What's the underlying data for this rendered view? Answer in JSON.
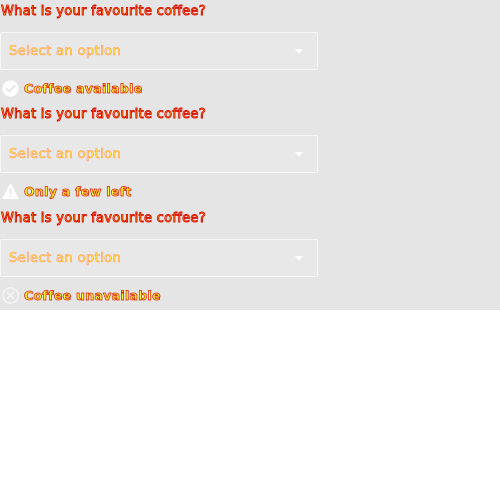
{
  "fields": [
    {
      "question": "What is your favourite coffee?",
      "select_value": "Select an option",
      "status_icon": "check-circle-icon",
      "status_text": "Coffee available"
    },
    {
      "question": "What is your favourite coffee?",
      "select_value": "Select an option",
      "status_icon": "warning-triangle-icon",
      "status_text": "Only a few left"
    },
    {
      "question": "What is your favourite coffee?",
      "select_value": "Select an option",
      "status_icon": "cross-circle-icon",
      "status_text": "Coffee unavailable"
    }
  ],
  "colors": {
    "panel_background": "#e5e5e5",
    "text_fill": "#ffff33",
    "text_outline": "#dd1100",
    "icon": "#ffffff"
  }
}
